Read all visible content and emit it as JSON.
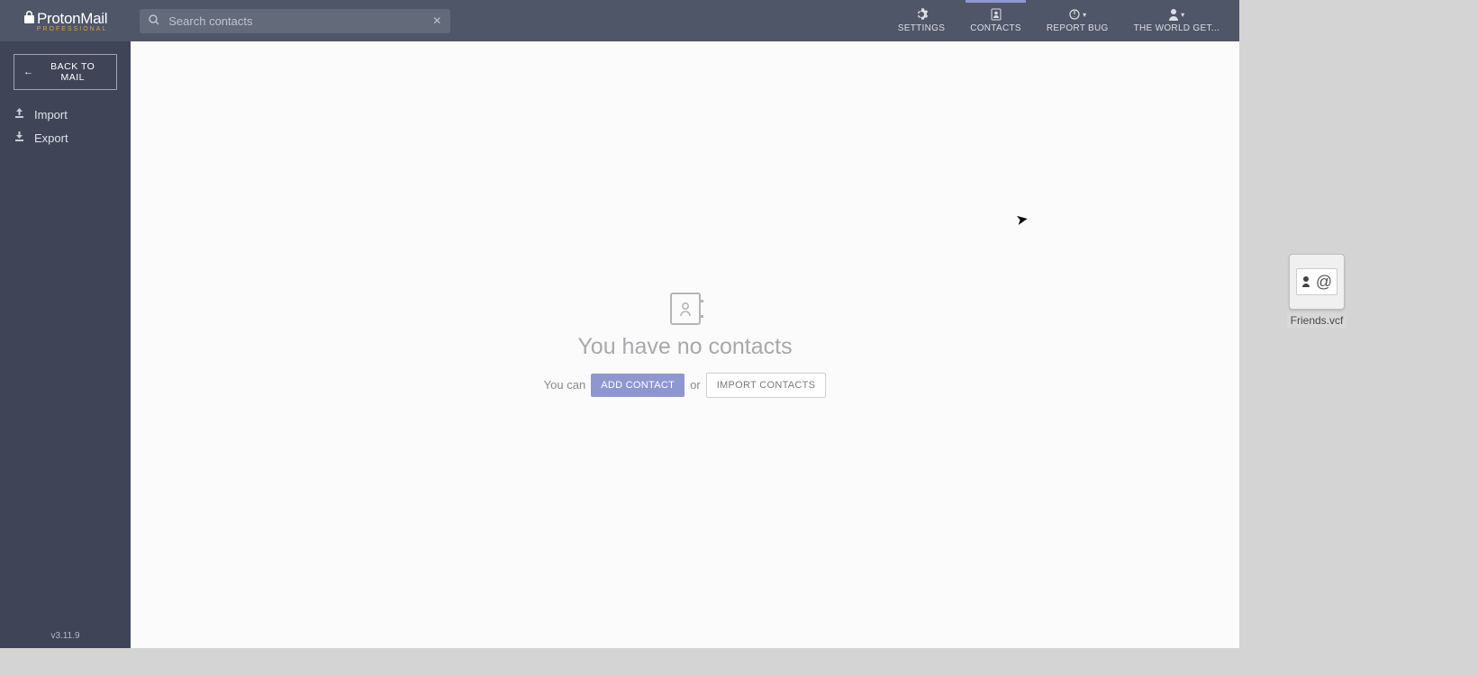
{
  "header": {
    "logo_main": "ProtonMail",
    "logo_sub": "PROFESSIONAL",
    "search_placeholder": "Search contacts"
  },
  "nav": {
    "settings": "SETTINGS",
    "contacts": "CONTACTS",
    "report_bug": "REPORT BUG",
    "account": "THE WORLD GET..."
  },
  "sidebar": {
    "back_label": "BACK TO MAIL",
    "import_label": "Import",
    "export_label": "Export",
    "version": "v3.11.9"
  },
  "empty_state": {
    "title": "You have no contacts",
    "prefix": "You can",
    "add_btn": "ADD CONTACT",
    "or_text": "or",
    "import_btn": "IMPORT CONTACTS"
  },
  "desktop": {
    "file_name": "Friends.vcf"
  }
}
